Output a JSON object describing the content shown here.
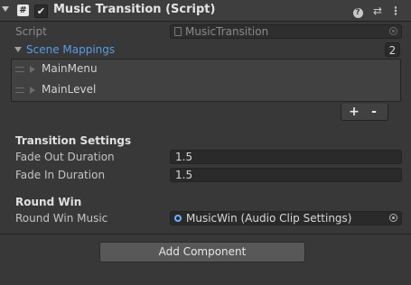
{
  "header": {
    "title": "Music Transition (Script)",
    "script_glyph": "#",
    "enabled_glyph": "✔",
    "help_glyph": "?",
    "presets_glyph": "⇄",
    "more_glyph": "⋮"
  },
  "script_field": {
    "label": "Script",
    "value": "MusicTransition"
  },
  "scene_mappings": {
    "label": "Scene Mappings",
    "count": "2",
    "items": [
      {
        "label": "MainMenu"
      },
      {
        "label": "MainLevel"
      }
    ],
    "add_label": "+",
    "remove_label": "-"
  },
  "transition_settings": {
    "header": "Transition Settings",
    "fade_out": {
      "label": "Fade Out Duration",
      "value": "1.5"
    },
    "fade_in": {
      "label": "Fade In Duration",
      "value": "1.5"
    }
  },
  "round_win": {
    "header": "Round Win",
    "music": {
      "label": "Round Win Music",
      "value": "MusicWin (Audio Clip Settings)"
    }
  },
  "add_component_label": "Add Component",
  "colors": {
    "accent": "#5a9be6",
    "background": "#383838",
    "field": "#2a2a2a"
  }
}
